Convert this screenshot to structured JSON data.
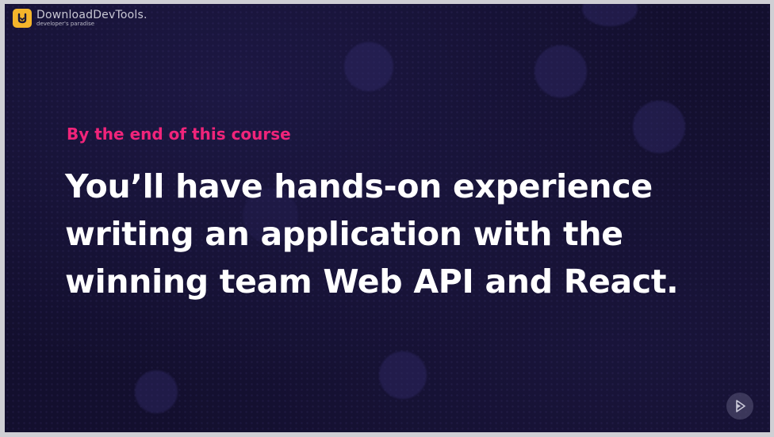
{
  "watermark": {
    "title": "DownloadDevTools.",
    "subtitle": "developer's paradise"
  },
  "slide": {
    "kicker": "By the end of this course",
    "headline_lines": [
      "You’ll have hands-on experience",
      "writing an application with the",
      "winning team Web API and React."
    ]
  },
  "icons": {
    "logo": "download-logo-icon",
    "player": "pluralsight-play-icon"
  },
  "colors": {
    "background": "#130f2e",
    "accent": "#f0247a",
    "headline": "#ffffff",
    "logo_mark": "#f5b52b"
  }
}
